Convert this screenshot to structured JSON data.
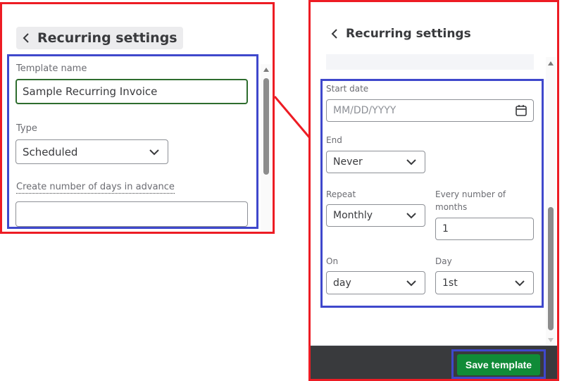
{
  "annotation_colors": {
    "outer_frame": "#ed1c24",
    "inner_highlight": "#3f48cc",
    "primary_button": "#108b38",
    "footer": "#393a3d",
    "focus_border": "#2e6d2e"
  },
  "left_panel": {
    "header": {
      "back_icon": "chevron-left-icon",
      "title": "Recurring settings"
    },
    "template_name": {
      "label": "Template name",
      "value": "Sample Recurring Invoice"
    },
    "type": {
      "label": "Type",
      "selected": "Scheduled",
      "icon": "chevron-down-icon"
    },
    "advance_days": {
      "label": "Create number of days in advance",
      "value": ""
    }
  },
  "right_panel": {
    "header": {
      "back_icon": "chevron-left-icon",
      "title": "Recurring settings"
    },
    "start_date": {
      "label": "Start date",
      "placeholder": "MM/DD/YYYY",
      "icon": "calendar-icon"
    },
    "end": {
      "label": "End",
      "selected": "Never"
    },
    "repeat": {
      "label": "Repeat",
      "selected": "Monthly"
    },
    "every_months": {
      "label_line1": "Every number of",
      "label_line2": "months",
      "value": "1"
    },
    "on": {
      "label": "On",
      "selected": "day"
    },
    "day": {
      "label": "Day",
      "selected": "1st"
    },
    "footer": {
      "save_label": "Save template"
    }
  }
}
